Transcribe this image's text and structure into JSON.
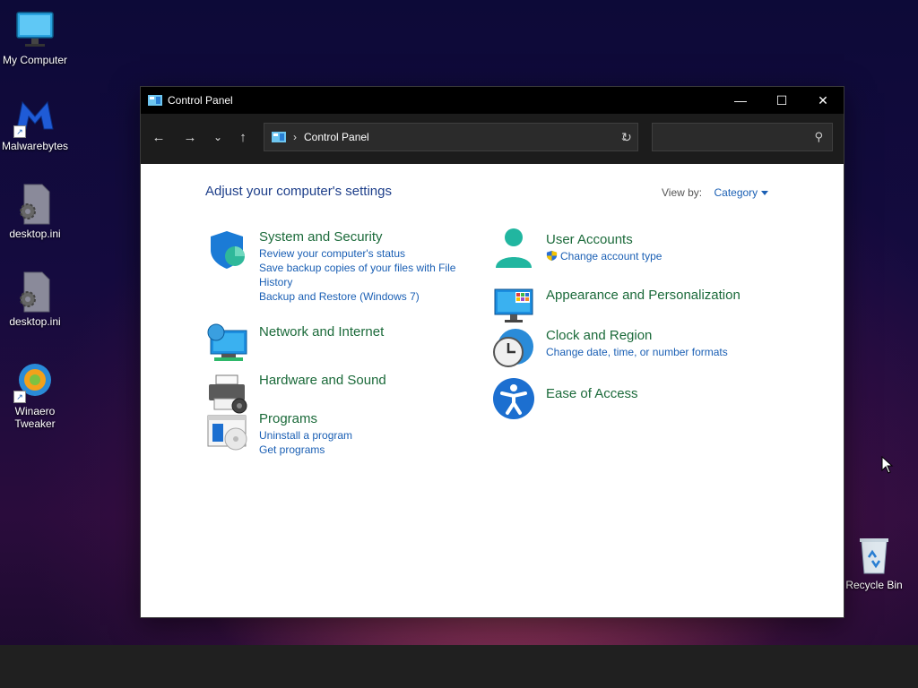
{
  "desktop": {
    "icons": [
      {
        "label": "My Computer"
      },
      {
        "label": "Malwarebytes"
      },
      {
        "label": "desktop.ini"
      },
      {
        "label": "desktop.ini"
      },
      {
        "label": "Winaero Tweaker"
      },
      {
        "label": "Recycle Bin"
      }
    ]
  },
  "window": {
    "title": "Control Panel",
    "controls": {
      "minimize": "—",
      "maximize": "☐",
      "close": "✕"
    },
    "nav": {
      "back": "←",
      "forward": "→",
      "recent": "⌄",
      "up": "↑"
    },
    "address": {
      "path": "Control Panel",
      "separator": "›"
    },
    "search": {
      "placeholder": ""
    }
  },
  "content": {
    "heading": "Adjust your computer's settings",
    "view_by": {
      "label": "View by:",
      "value": "Category"
    },
    "categories": [
      {
        "title": "System and Security",
        "links": [
          "Review your computer's status",
          "Save backup copies of your files with File History",
          "Backup and Restore (Windows 7)"
        ]
      },
      {
        "title": "Network and Internet",
        "links": []
      },
      {
        "title": "Hardware and Sound",
        "links": []
      },
      {
        "title": "Programs",
        "links": [
          "Uninstall a program",
          "Get programs"
        ]
      },
      {
        "title": "User Accounts",
        "links": [
          "Change account type"
        ]
      },
      {
        "title": "Appearance and Personalization",
        "links": []
      },
      {
        "title": "Clock and Region",
        "links": [
          "Change date, time, or number formats"
        ]
      },
      {
        "title": "Ease of Access",
        "links": []
      }
    ]
  },
  "colors": {
    "title_green": "#1b6a3a",
    "link_blue": "#1a5fb4",
    "heading_blue": "#1e3f8a",
    "titlebar": "#000000",
    "navbar": "#1c1c1c"
  }
}
